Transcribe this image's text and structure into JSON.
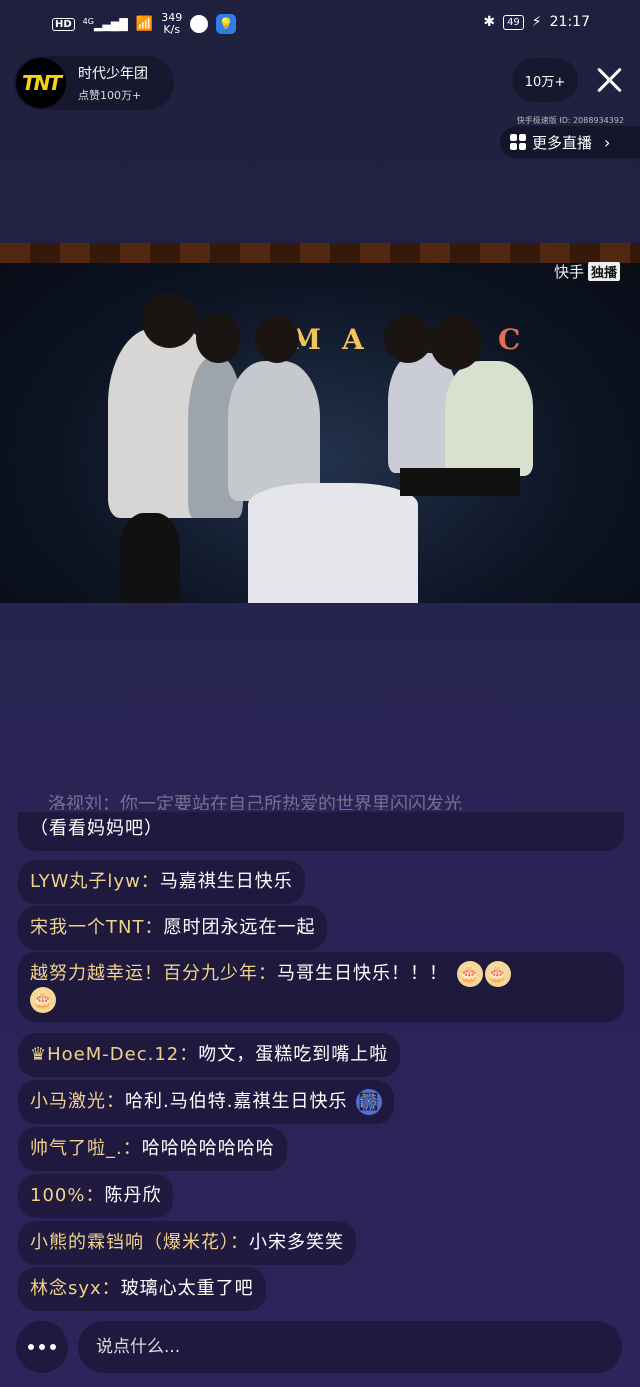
{
  "status_bar": {
    "network": "HD",
    "signal": "4G",
    "speed_value": "349",
    "speed_unit": "K/s",
    "battery": "49",
    "time": "21:17"
  },
  "anchor": {
    "avatar_text": "TNT",
    "name": "时代少年团",
    "likes": "点赞100万+"
  },
  "viewers": "10万+",
  "version": "快手极速版 ID: 2088934392",
  "more_live": "更多直播",
  "video": {
    "watermark_app": "快手",
    "watermark_badge": "独播",
    "stage_letters": [
      "M",
      "A",
      "C"
    ]
  },
  "chat": {
    "faded_text": "洛视刘：你一定要站在自己所热爱的世界里闪闪发光",
    "first_continuation": "（看看妈妈吧）",
    "messages": [
      {
        "user": "LYW丸子lyw：",
        "text": "马嘉祺生日快乐"
      },
      {
        "user": "宋我一个TNT：",
        "text": "愿时团永远在一起"
      },
      {
        "user": "越努力越幸运！百分九少年：",
        "text": "马哥生日快乐！！！"
      },
      {
        "user": "♛HoeM-Dec.12：",
        "text": "吻文，蛋糕吃到嘴上啦"
      },
      {
        "user": "小马激光：",
        "text": "哈利.马伯特.嘉祺生日快乐"
      },
      {
        "user": "帅气了啦_.：",
        "text": "哈哈哈哈哈哈哈"
      },
      {
        "user": "100%：",
        "text": "陈丹欣"
      },
      {
        "user": "小熊的霖铛响（爆米花）：",
        "text": "小宋多笑笑"
      },
      {
        "user": "林念syx：",
        "text": "玻璃心太重了吧"
      }
    ]
  },
  "input": {
    "placeholder": "说点什么..."
  },
  "colors": {
    "username": "#f1d28a",
    "background_top": "#1f1f3e",
    "background_bottom": "#2e235a"
  }
}
